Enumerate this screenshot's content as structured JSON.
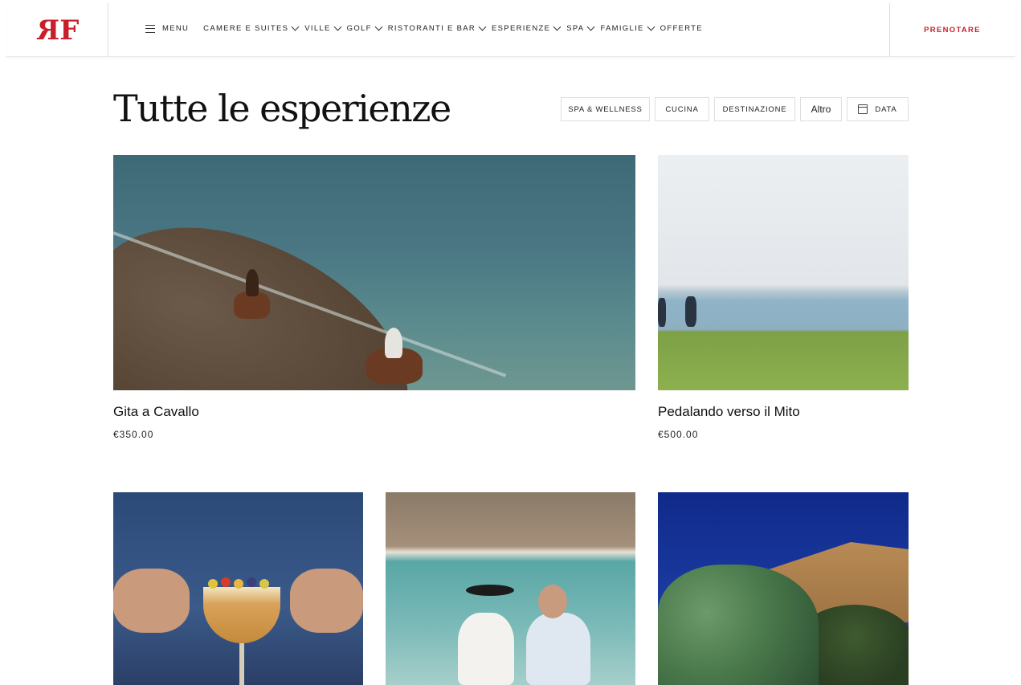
{
  "header": {
    "logo_text": "RF",
    "menu_label": "MENU",
    "nav_items": [
      {
        "label": "CAMERE E SUITES",
        "has_dropdown": true
      },
      {
        "label": "VILLE",
        "has_dropdown": true
      },
      {
        "label": "GOLF",
        "has_dropdown": true
      },
      {
        "label": "RISTORANTI E BAR",
        "has_dropdown": true
      },
      {
        "label": "ESPERIENZE",
        "has_dropdown": true
      },
      {
        "label": "SPA",
        "has_dropdown": true
      },
      {
        "label": "FAMIGLIE",
        "has_dropdown": true
      },
      {
        "label": "OFFERTE",
        "has_dropdown": false
      }
    ],
    "book_label": "PRENOTARE"
  },
  "main": {
    "title": "Tutte le esperienze",
    "filters": [
      "SPA & WELLNESS",
      "CUCINA",
      "DESTINAZIONE",
      "Altro",
      "DATA"
    ]
  },
  "cards": [
    {
      "title": "Gita a Cavallo",
      "price": "€350.00",
      "image": "horse-riding-beach"
    },
    {
      "title": "Pedalando verso il Mito",
      "price": "€500.00",
      "image": "cycling-coast"
    },
    {
      "title": "",
      "price": "",
      "image": "cocktail"
    },
    {
      "title": "",
      "price": "",
      "image": "couple-beach"
    },
    {
      "title": "",
      "price": "",
      "image": "greek-temple"
    }
  ],
  "colors": {
    "brand_red": "#c8202a",
    "text": "#111111",
    "border": "#dedede"
  }
}
